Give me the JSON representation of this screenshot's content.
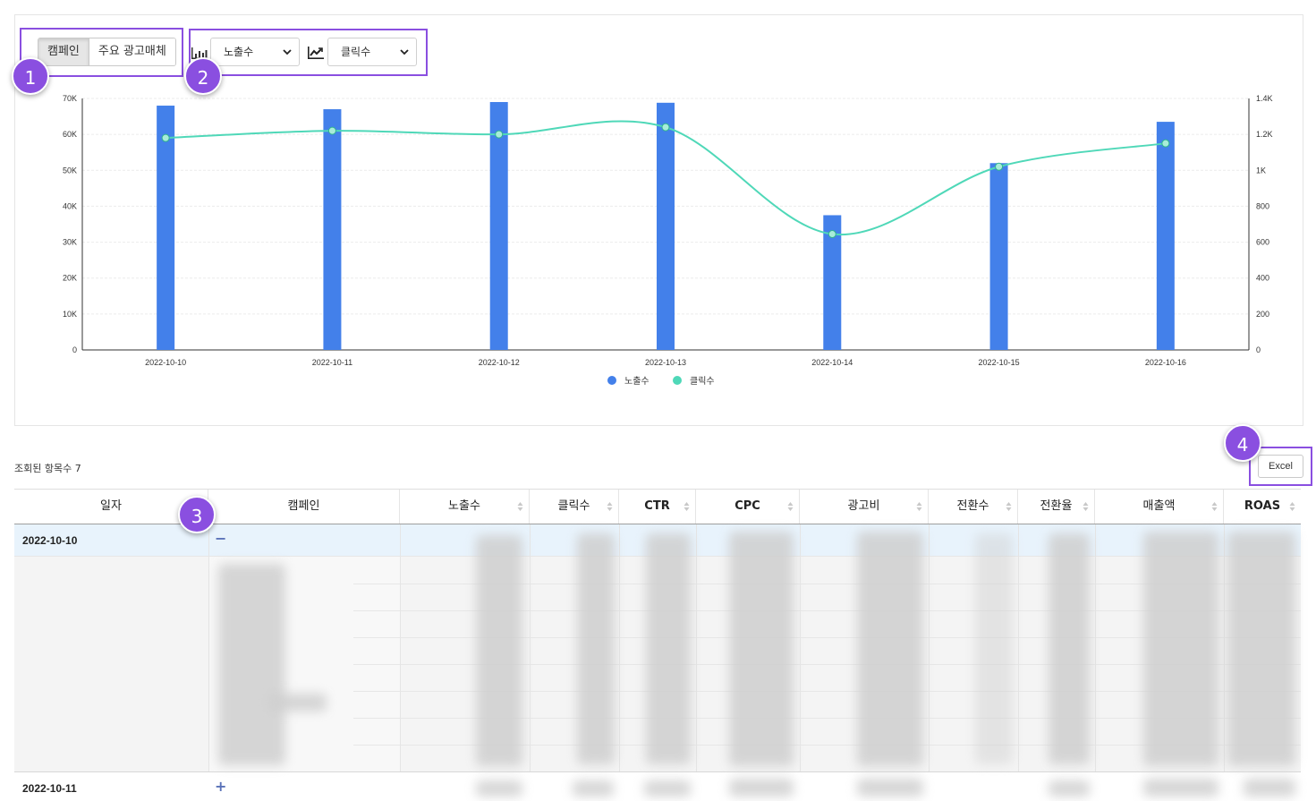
{
  "view_toggle": {
    "options": [
      "캠페인",
      "주요 광고매체"
    ],
    "active": "캠페인"
  },
  "metric_selects": {
    "bar_metric": "노출수",
    "line_metric": "클릭수",
    "bar_icon": "bar-chart-icon",
    "line_icon": "line-chart-icon"
  },
  "callouts": [
    "1",
    "2",
    "3",
    "4"
  ],
  "chart_data": {
    "type": "bar",
    "categories": [
      "2022-10-10",
      "2022-10-11",
      "2022-10-12",
      "2022-10-13",
      "2022-10-14",
      "2022-10-15",
      "2022-10-16"
    ],
    "category_colors": [
      "#333333",
      "#333333",
      "#333333",
      "#333333",
      "#333333",
      "#2a3bd6",
      "#e0201b"
    ],
    "series": [
      {
        "name": "노출수",
        "type": "bar",
        "axis": "left",
        "color": "#4380ea",
        "values": [
          68000,
          67000,
          69000,
          68800,
          37500,
          52000,
          63500
        ]
      },
      {
        "name": "클릭수",
        "type": "line",
        "axis": "right",
        "color": "#4fd8b8",
        "values": [
          1180,
          1220,
          1200,
          1240,
          645,
          1020,
          1150
        ]
      }
    ],
    "left_axis": {
      "ylim": [
        0,
        70000
      ],
      "ticks": [
        "0",
        "10K",
        "20K",
        "30K",
        "40K",
        "50K",
        "60K",
        "70K"
      ]
    },
    "right_axis": {
      "ylim": [
        0,
        1400
      ],
      "ticks": [
        "0",
        "200",
        "400",
        "600",
        "800",
        "1K",
        "1.2K",
        "1.4K"
      ]
    },
    "legend_position": "bottom-center",
    "grid": true
  },
  "table": {
    "count_label": "조회된 항목수 7",
    "excel_label": "Excel",
    "headers": [
      "일자",
      "캠페인",
      "노출수",
      "클릭수",
      "CTR",
      "CPC",
      "광고비",
      "전환수",
      "전환율",
      "매출액",
      "ROAS"
    ],
    "rows": [
      {
        "date": "2022-10-10",
        "expander": "−"
      },
      {
        "date": "2022-10-11",
        "expander": "+"
      }
    ]
  }
}
